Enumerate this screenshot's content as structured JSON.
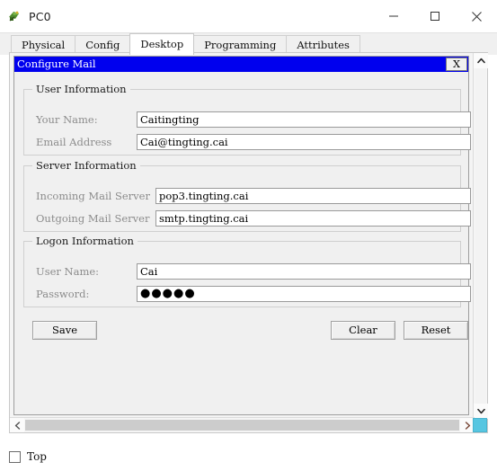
{
  "window": {
    "title": "PC0",
    "icon": "router-pc-icon",
    "controls": {
      "minimize": "minimize-icon",
      "maximize": "maximize-icon",
      "close": "close-icon"
    }
  },
  "tabs": [
    {
      "label": "Physical",
      "selected": false
    },
    {
      "label": "Config",
      "selected": false
    },
    {
      "label": "Desktop",
      "selected": true
    },
    {
      "label": "Programming",
      "selected": false
    },
    {
      "label": "Attributes",
      "selected": false
    }
  ],
  "mdi": {
    "title": "Configure Mail",
    "close_label": "X"
  },
  "groups": {
    "user": {
      "title": "User Information",
      "fields": [
        {
          "label": "Your Name:",
          "value": "Caitingting"
        },
        {
          "label": "Email Address",
          "value": "Cai@tingting.cai"
        }
      ]
    },
    "server": {
      "title": "Server Information",
      "fields": [
        {
          "label": "Incoming Mail Server",
          "value": "pop3.tingting.cai"
        },
        {
          "label": "Outgoing Mail Server",
          "value": "smtp.tingting.cai"
        }
      ]
    },
    "logon": {
      "title": "Logon Information",
      "fields": [
        {
          "label": "User Name:",
          "value": "Cai"
        },
        {
          "label": "Password:",
          "value": "●●●●●"
        }
      ]
    }
  },
  "buttons": {
    "save": "Save",
    "clear": "Clear",
    "reset": "Reset"
  },
  "scrollbars": {
    "up_arrow": "chevron-up-icon",
    "down_arrow": "chevron-down-icon",
    "left_arrow": "chevron-left-icon",
    "right_arrow": "chevron-right-icon",
    "corner_color": "#57c6e1"
  },
  "bottom": {
    "top_checkbox_label": "Top",
    "top_checked": false
  }
}
